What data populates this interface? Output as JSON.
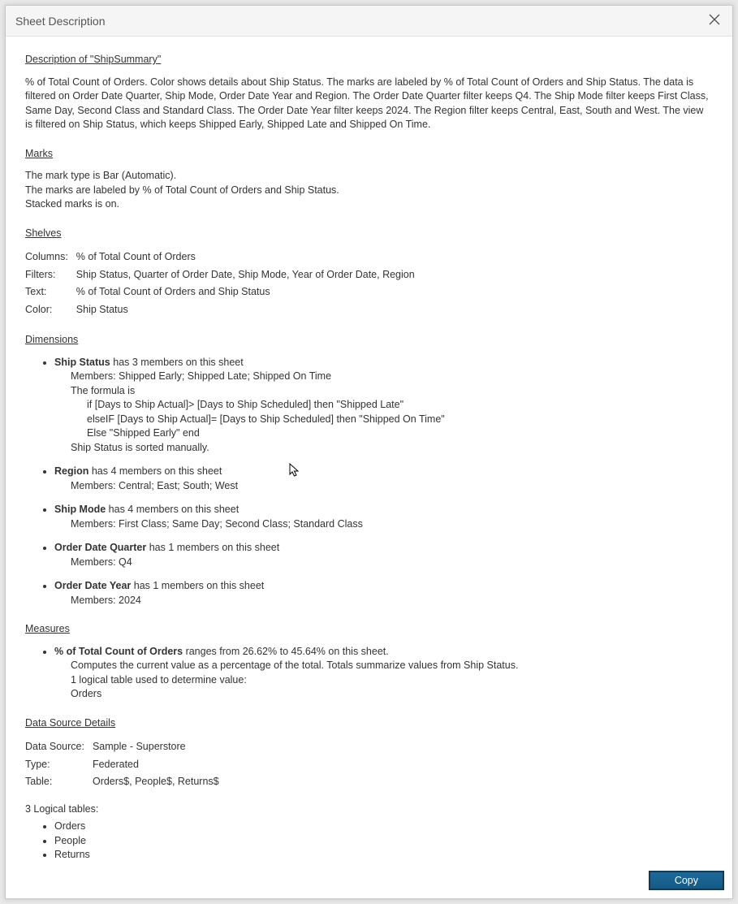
{
  "dialog": {
    "title": "Sheet Description",
    "copy_button": "Copy"
  },
  "description": {
    "heading": "Description of \"ShipSummary\"",
    "body": "% of Total Count of Orders.  Color shows details about Ship Status.  The marks are labeled by % of Total Count of Orders and Ship Status. The data is filtered on Order Date Quarter, Ship Mode, Order Date Year and Region. The Order Date Quarter filter keeps Q4. The Ship Mode filter keeps First Class, Same Day, Second Class and Standard Class. The Order Date Year filter keeps 2024. The Region filter keeps Central, East, South and West. The view is filtered on Ship Status, which keeps Shipped Early, Shipped Late and Shipped On Time."
  },
  "marks": {
    "heading": "Marks",
    "line1": "The mark type is Bar (Automatic).",
    "line2": "The marks are labeled by % of Total Count of Orders and Ship Status.",
    "line3": "Stacked marks is on."
  },
  "shelves": {
    "heading": "Shelves",
    "rows": {
      "columns_key": "Columns:",
      "columns_val": "% of Total Count of Orders",
      "filters_key": "Filters:",
      "filters_val": "Ship Status, Quarter of Order Date, Ship Mode, Year of Order Date, Region",
      "text_key": "Text:",
      "text_val": "% of Total Count of Orders and Ship Status",
      "color_key": "Color:",
      "color_val": "Ship Status"
    }
  },
  "dimensions": {
    "heading": "Dimensions",
    "ship_status": {
      "name": "Ship Status",
      "tail": " has 3 members on this sheet",
      "members": "Members: Shipped Early; Shipped Late; Shipped On Time",
      "formula_intro": "The formula is",
      "formula_l1": "if [Days to Ship Actual]> [Days to Ship Scheduled] then \"Shipped Late\"",
      "formula_l2": "elseIF [Days to Ship Actual]= [Days to Ship Scheduled] then \"Shipped On Time\"",
      "formula_l3": "Else \"Shipped Early\" end",
      "sort_note": "Ship Status is sorted manually."
    },
    "region": {
      "name": "Region",
      "tail": " has 4 members on this sheet",
      "members": "Members: Central; East; South; West"
    },
    "ship_mode": {
      "name": "Ship Mode",
      "tail": " has 4 members on this sheet",
      "members": "Members: First Class; Same Day; Second Class; Standard Class"
    },
    "order_date_quarter": {
      "name": "Order Date Quarter",
      "tail": " has 1 members on this sheet",
      "members": "Members: Q4"
    },
    "order_date_year": {
      "name": "Order Date Year",
      "tail": " has 1 members on this sheet",
      "members": "Members: 2024"
    }
  },
  "measures": {
    "heading": "Measures",
    "item": {
      "name": "% of Total Count of Orders",
      "tail": " ranges from 26.62% to 45.64% on this sheet.",
      "computes": "Computes the current value as a percentage of the total.  Totals summarize values from Ship Status.",
      "logical": "1 logical table used to determine value:",
      "table": "Orders"
    }
  },
  "datasource": {
    "heading": "Data Source Details",
    "rows": {
      "ds_key": "Data Source:",
      "ds_val": "Sample - Superstore",
      "type_key": "Type:",
      "type_val": "Federated",
      "table_key": "Table:",
      "table_val": "Orders$, People$, Returns$"
    },
    "logical_tables_intro": "3 Logical tables:",
    "logical_tables": {
      "t1": "Orders",
      "t2": "People",
      "t3": "Returns"
    }
  }
}
